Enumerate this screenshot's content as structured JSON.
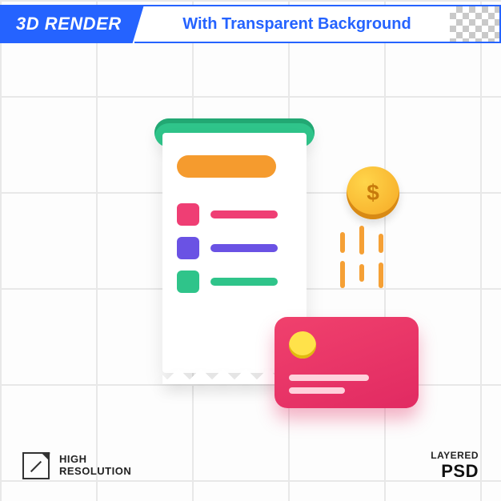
{
  "header": {
    "badge": "3D RENDER",
    "title": "With Transparent Background"
  },
  "footer": {
    "left_line1": "HIGH",
    "left_line2": "RESOLUTION",
    "right_line1": "LAYERED",
    "right_line2": "PSD"
  },
  "coin": {
    "symbol": "$"
  },
  "colors": {
    "blue": "#2563ff",
    "green": "#2fc48a",
    "orange": "#f59b2e",
    "pink": "#ef3e74",
    "purple": "#6a52e4",
    "cardPink": "#e12a62",
    "yellow": "#ffe24a"
  }
}
